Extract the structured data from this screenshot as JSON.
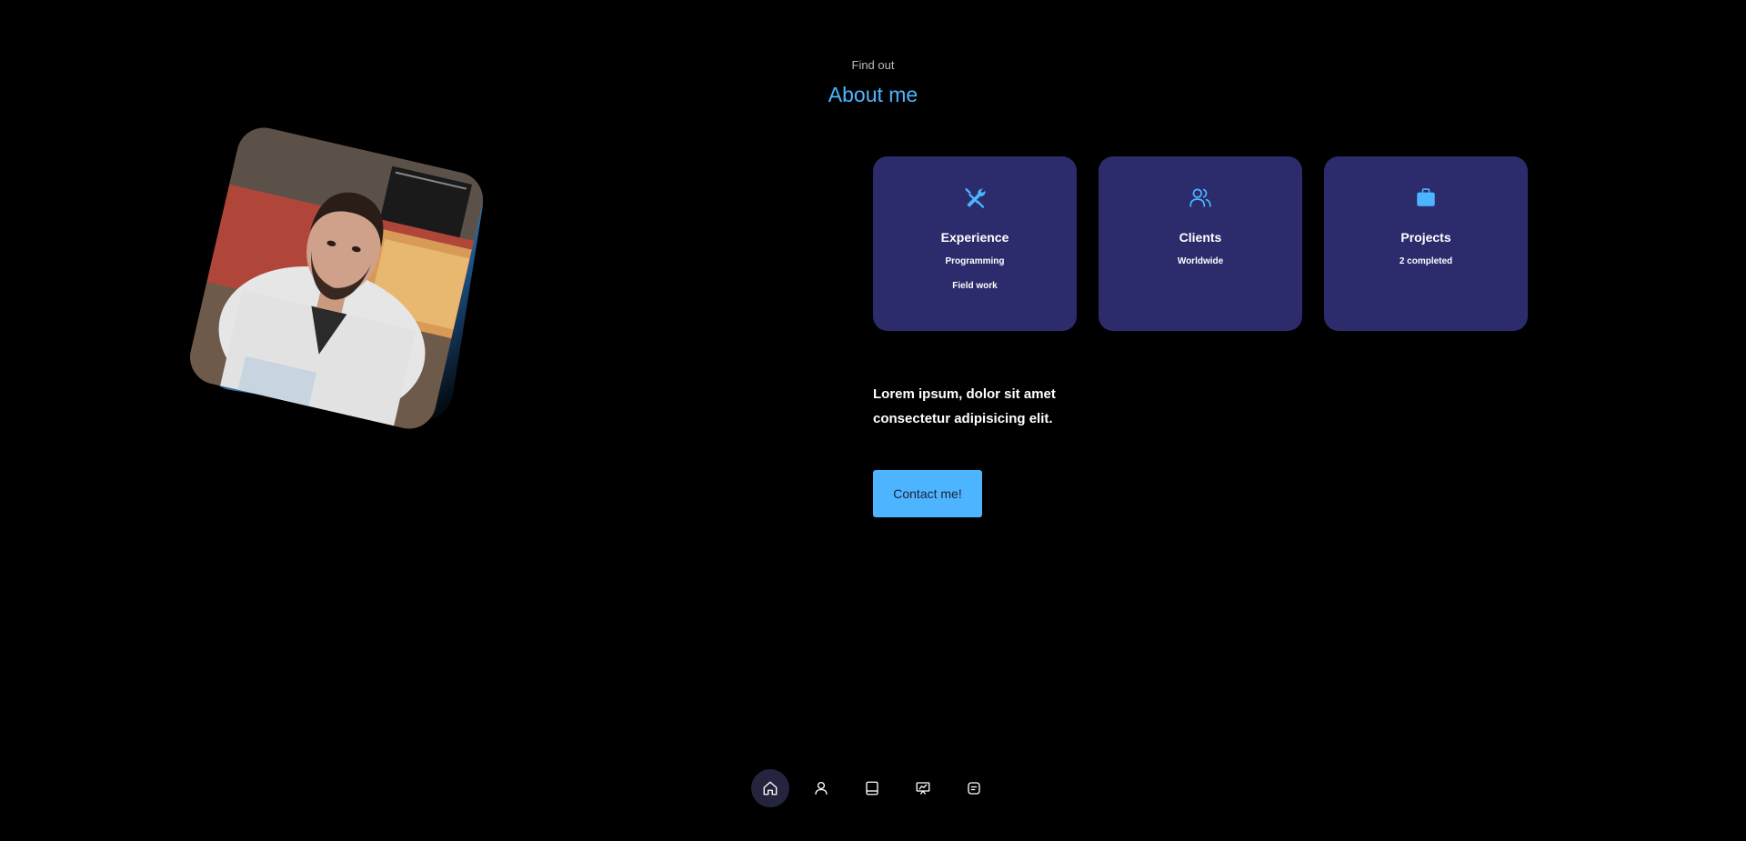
{
  "header": {
    "subtitle": "Find out",
    "title": "About me"
  },
  "profile_image": {
    "alt": "Portrait photo",
    "accent_color": "#4db5ff"
  },
  "cards": [
    {
      "icon": "tools-icon",
      "title": "Experience",
      "lines": [
        "Programming",
        "Field work"
      ]
    },
    {
      "icon": "users-icon",
      "title": "Clients",
      "lines": [
        "Worldwide"
      ]
    },
    {
      "icon": "briefcase-icon",
      "title": "Projects",
      "lines": [
        "2 completed"
      ]
    }
  ],
  "description": "Lorem ipsum, dolor sit amet consectetur adipisicing elit.",
  "contact_button": {
    "label": "Contact me!"
  },
  "nav": {
    "items": [
      {
        "icon": "home-icon",
        "active": true
      },
      {
        "icon": "user-icon",
        "active": false
      },
      {
        "icon": "book-icon",
        "active": false
      },
      {
        "icon": "presentation-icon",
        "active": false
      },
      {
        "icon": "message-icon",
        "active": false
      }
    ]
  },
  "colors": {
    "background": "#000000",
    "accent": "#4db5ff",
    "card": "#2c2c6c",
    "text_muted": "#b9b9c3"
  }
}
